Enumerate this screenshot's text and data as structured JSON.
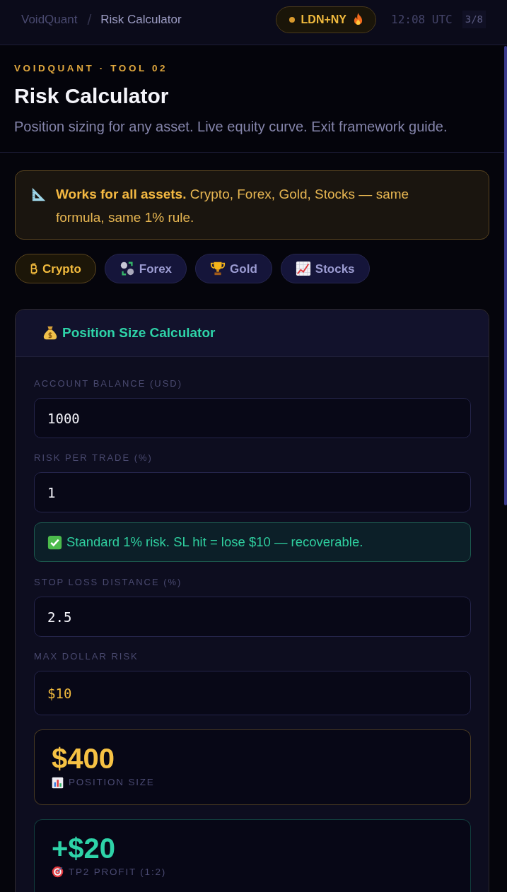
{
  "nav": {
    "breadcrumb": {
      "parent": "VoidQuant",
      "separator": "/",
      "current": "Risk Calculator"
    },
    "session": "LDN+NY",
    "clock": "12:08 UTC",
    "page_counter": "3/8"
  },
  "header": {
    "eyebrow": "VOIDQUANT · TOOL 02",
    "title": "Risk Calculator",
    "subtitle": "Position sizing for any asset. Live equity curve. Exit framework guide."
  },
  "notice": {
    "text": "**Works for all assets.** Crypto, Forex, Gold, Stocks — same formula, same 1% rule."
  },
  "asset_tabs": [
    {
      "label": "Crypto",
      "selected": true
    },
    {
      "label": "Forex",
      "selected": false
    },
    {
      "label": "Gold",
      "selected": false
    },
    {
      "label": "Stocks",
      "selected": false
    }
  ],
  "calculator": {
    "title": "Position Size Calculator",
    "fields": [
      {
        "kind": "input",
        "label": "ACCOUNT BALANCE (USD)",
        "value": "1000"
      },
      {
        "kind": "input",
        "label": "RISK PER TRADE (%)",
        "value": "1"
      },
      {
        "kind": "note",
        "text": "Standard 1% risk. SL hit = lose $10 — recoverable."
      },
      {
        "kind": "input",
        "label": "STOP LOSS DISTANCE (%)",
        "value": "2.5"
      },
      {
        "kind": "readout",
        "label": "MAX DOLLAR RISK",
        "value": "$10"
      }
    ],
    "results": [
      {
        "value": "$400",
        "label": "POSITION SIZE",
        "color": "#f6c244"
      },
      {
        "value": "+$20",
        "label": "TP2 PROFIT (1:2)",
        "color": "#2ed3a8"
      }
    ]
  }
}
